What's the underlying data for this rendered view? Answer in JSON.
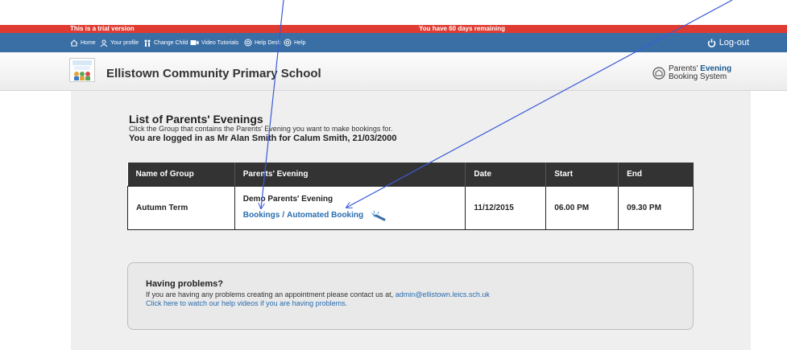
{
  "trial_bar": {
    "left_text": "This is a trial version",
    "center_text": "You have 60 days remaining"
  },
  "nav": {
    "items": [
      {
        "label": "Home",
        "icon": "home-icon"
      },
      {
        "label": "Your profile",
        "icon": "profile-icon"
      },
      {
        "label": "Change Child",
        "icon": "change-child-icon"
      },
      {
        "label": "Video Tutorials",
        "icon": "video-icon"
      },
      {
        "label": "Help Desk",
        "icon": "help-desk-icon"
      },
      {
        "label": "Help",
        "icon": "help-icon"
      }
    ],
    "logout_label": "Log-out"
  },
  "header": {
    "school_name": "Ellistown Community Primary School",
    "brand_line1": "Parents'",
    "brand_line1_bold": "Evening",
    "brand_line2": "Booking System"
  },
  "main": {
    "title": "List of Parents' Evenings",
    "subtitle": "Click the Group that contains the Parents' Evening you want to make bookings for.",
    "logged_in": "You are logged in as Mr Alan Smith for Calum Smith, 21/03/2000"
  },
  "table": {
    "headers": [
      "Name of Group",
      "Parents' Evening",
      "Date",
      "Start",
      "End"
    ],
    "rows": [
      {
        "group": "Autumn Term",
        "evening": "Demo Parents' Evening",
        "bookings_link": "Bookings",
        "separator": "/",
        "automated_link": "Automated Booking",
        "date": "11/12/2015",
        "start": "06.00 PM",
        "end": "09.30 PM"
      }
    ]
  },
  "help": {
    "title": "Having problems?",
    "line1_text": "If you are having any problems creating an appointment please contact us at,",
    "email": "admin@ellistown.leics.sch.uk",
    "line2": "Click here to watch our help videos if you are having problems."
  },
  "colors": {
    "trial_bar": "#e03b30",
    "nav_bar": "#3a6fa6",
    "table_header": "#333333",
    "link": "#2a6db0",
    "annotation_arrow": "#3b5bd6"
  }
}
